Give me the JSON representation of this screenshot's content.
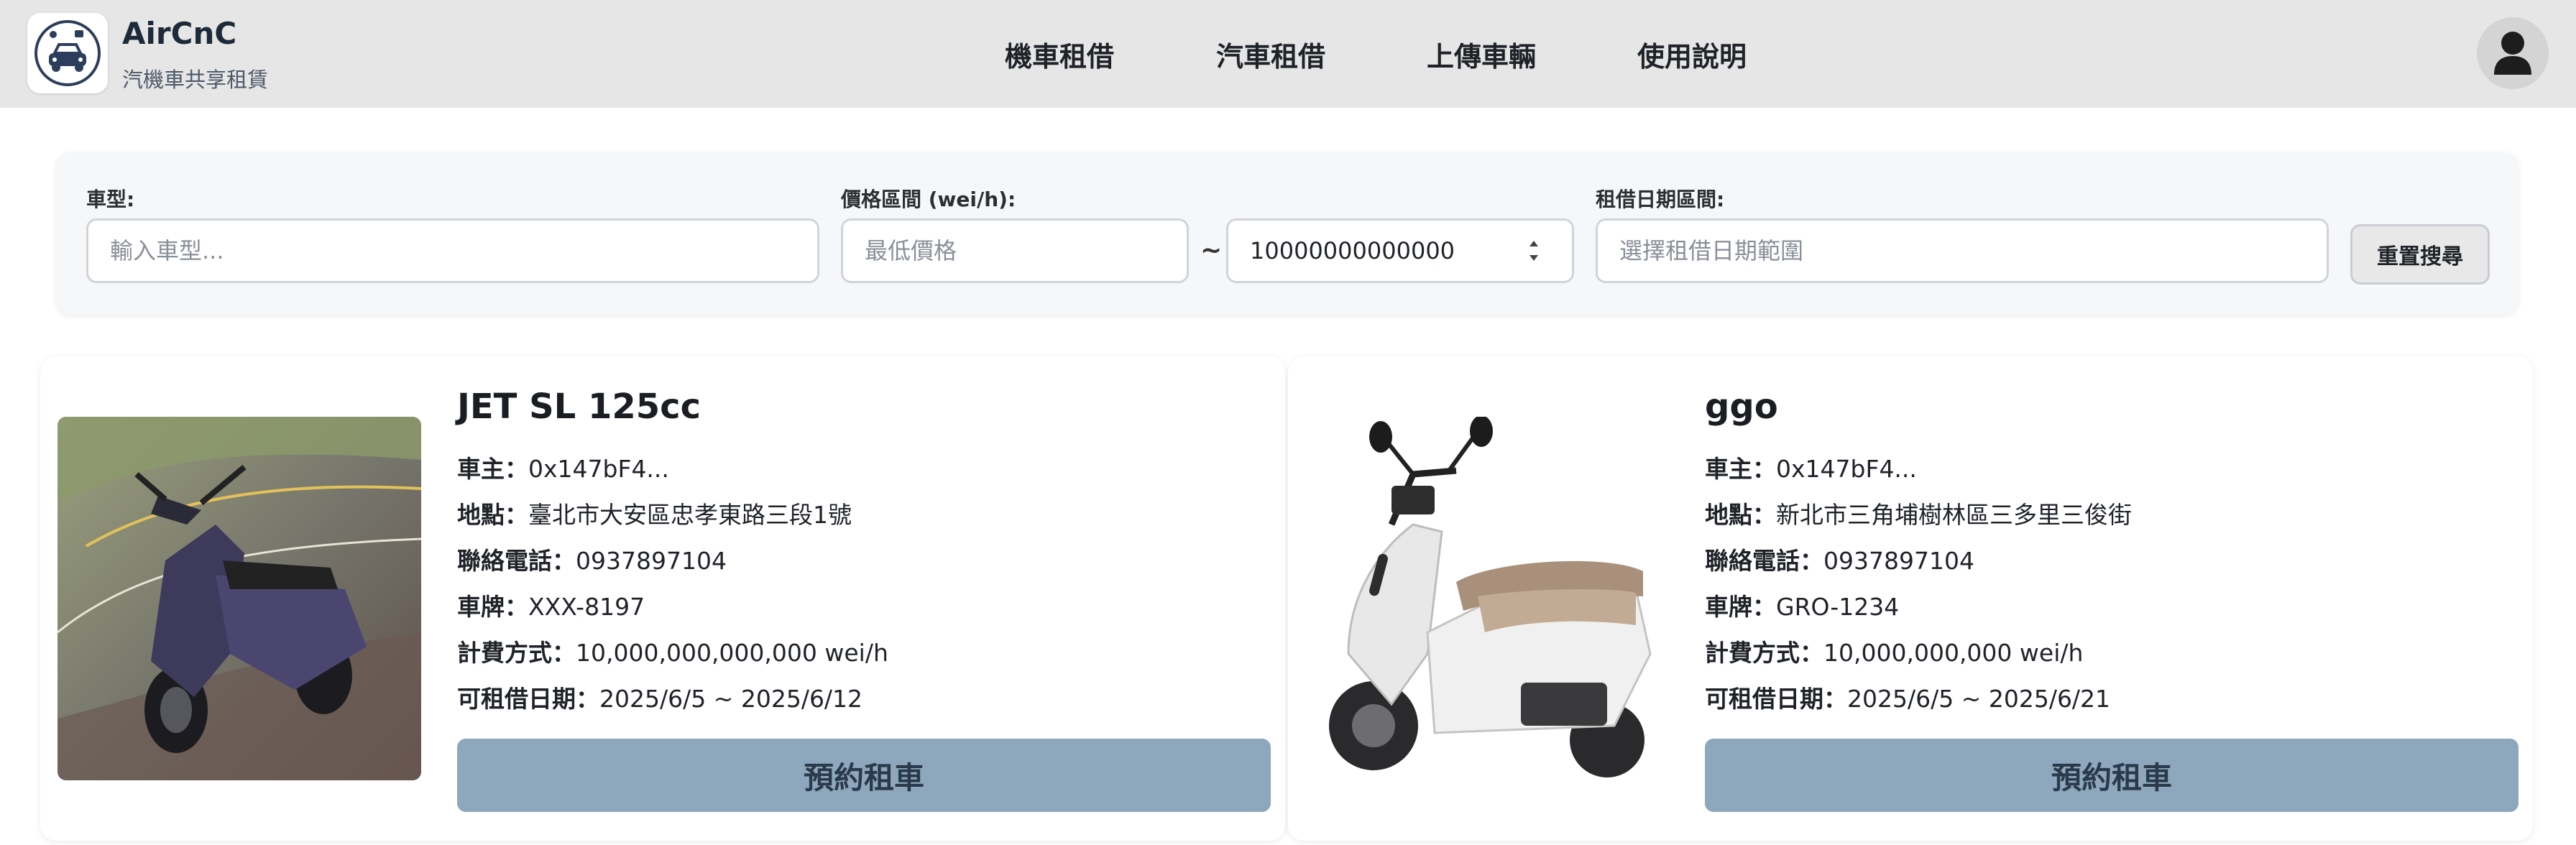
{
  "header": {
    "app_title": "AirCnC",
    "app_subtitle": "汽機車共享租賃",
    "nav": [
      {
        "label": "機車租借"
      },
      {
        "label": "汽車租借"
      },
      {
        "label": "上傳車輛"
      },
      {
        "label": "使用說明"
      }
    ],
    "avatar_icon": "user-icon"
  },
  "search": {
    "type_label": "車型:",
    "type_placeholder": "輸入車型...",
    "price_label": "價格區間 (wei/h):",
    "price_min_placeholder": "最低價格",
    "price_separator": "~",
    "price_max_value": "10000000000000",
    "date_label": "租借日期區間:",
    "date_placeholder": "選擇租借日期範圍",
    "reset_label": "重置搜尋"
  },
  "vehicles": [
    {
      "name": "JET SL 125cc",
      "owner_label": "車主：",
      "owner": "0x147bF4...",
      "location_label": "地點：",
      "location": "臺北市大安區忠孝東路三段1號",
      "phone_label": "聯絡電話：",
      "phone": "0937897104",
      "plate_label": "車牌：",
      "plate": "XXX-8197",
      "price_label": "計費方式：",
      "price": "10,000,000,000,000 wei/h",
      "dates_label": "可租借日期：",
      "dates": "2025/6/5 ~ 2025/6/12",
      "book_label": "預約租車"
    },
    {
      "name": "ggo",
      "owner_label": "車主：",
      "owner": "0x147bF4...",
      "location_label": "地點：",
      "location": "新北市三角埔樹林區三多里三俊街",
      "phone_label": "聯絡電話：",
      "phone": "0937897104",
      "plate_label": "車牌：",
      "plate": "GRO-1234",
      "price_label": "計費方式：",
      "price": "10,000,000,000 wei/h",
      "dates_label": "可租借日期：",
      "dates": "2025/6/5 ~ 2025/6/21",
      "book_label": "預約租車"
    }
  ],
  "colors": {
    "header_bg": "#e6e6e6",
    "book_button": "#8ea7bd",
    "logo_blue": "#2c3e5c"
  }
}
